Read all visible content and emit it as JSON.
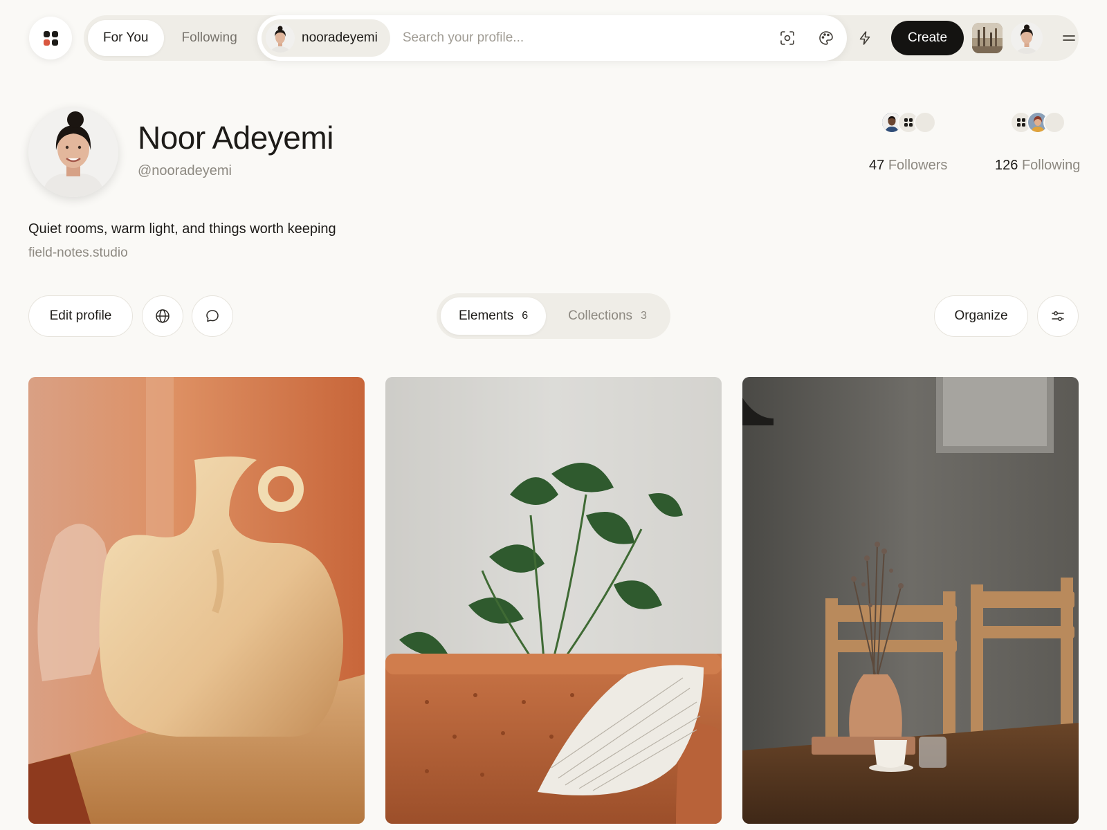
{
  "topbar": {
    "tabs": [
      {
        "label": "For You",
        "active": true
      },
      {
        "label": "Following",
        "active": false
      }
    ],
    "user_chip": "nooradeyemi",
    "search_placeholder": "Search your profile...",
    "create_label": "Create"
  },
  "profile": {
    "name": "Noor Adeyemi",
    "handle": "@nooradeyemi",
    "bio": "Quiet rooms, warm light, and things worth keeping",
    "link": "field-notes.studio",
    "followers": {
      "count": "47",
      "label": "Followers"
    },
    "following": {
      "count": "126",
      "label": "Following"
    }
  },
  "actions": {
    "edit_profile": "Edit profile",
    "organize": "Organize"
  },
  "content_tabs": [
    {
      "label": "Elements",
      "count": "6",
      "active": true
    },
    {
      "label": "Collections",
      "count": "3",
      "active": false
    }
  ],
  "icons": {
    "logo": "app-logo-icon",
    "visual_search": "scan-icon",
    "palette": "palette-icon",
    "bolt": "bolt-icon",
    "menu": "menu-icon",
    "globe": "globe-icon",
    "message": "chat-bubble-icon",
    "filters": "sliders-icon"
  },
  "colors": {
    "background": "#faf9f6",
    "primary_button": "#141311",
    "logo_accent": "#d9573f"
  }
}
